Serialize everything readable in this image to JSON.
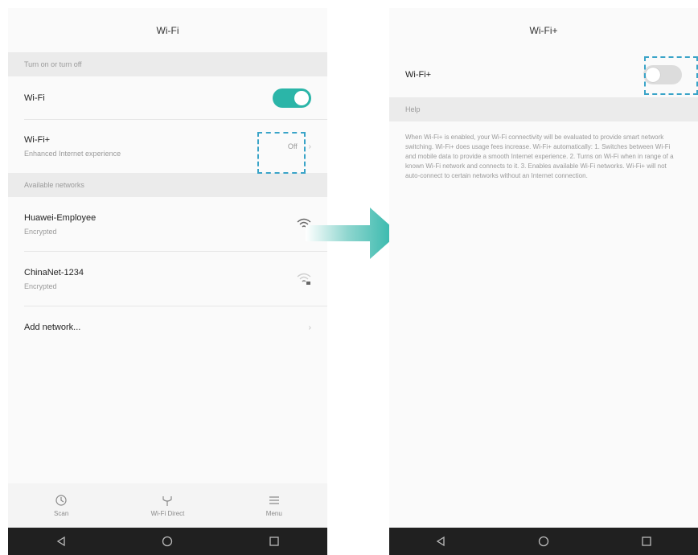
{
  "left": {
    "title": "Wi-Fi",
    "section_top": "Turn on or turn off",
    "wifi_label": "Wi-Fi",
    "wifi_enabled": true,
    "wifiplus_label": "Wi-Fi+",
    "wifiplus_sub": "Enhanced Internet experience",
    "wifiplus_status": "Off",
    "section_networks": "Available networks",
    "networks": [
      {
        "name": "Huawei-Employee",
        "status": "Encrypted"
      },
      {
        "name": "ChinaNet-1234",
        "status": "Encrypted"
      }
    ],
    "add_network": "Add network...",
    "bottom": [
      {
        "icon": "scan-icon",
        "label": "Scan"
      },
      {
        "icon": "wifi-direct-icon",
        "label": "Wi-Fi Direct"
      },
      {
        "icon": "menu-icon",
        "label": "Menu"
      }
    ]
  },
  "right": {
    "title": "Wi-Fi+",
    "wifiplus_label": "Wi-Fi+",
    "wifiplus_enabled": false,
    "section_help": "Help",
    "help_text": "When Wi-Fi+ is enabled, your Wi-Fi connectivity will be evaluated to provide smart network switching. Wi-Fi+ does usage fees increase. Wi-Fi+ automatically: 1. Switches between Wi-Fi and mobile data to provide a smooth Internet experience. 2. Turns on Wi-Fi when in range of a known Wi-Fi network and connects to it. 3. Enables available Wi-Fi networks. Wi-Fi+ will not auto-connect to certain networks without an Internet connection."
  },
  "colors": {
    "accent": "#2bb5a8",
    "highlight_dash": "#3aa4c8",
    "arrow": "#2bb5a8",
    "nav_bg": "#202020"
  }
}
